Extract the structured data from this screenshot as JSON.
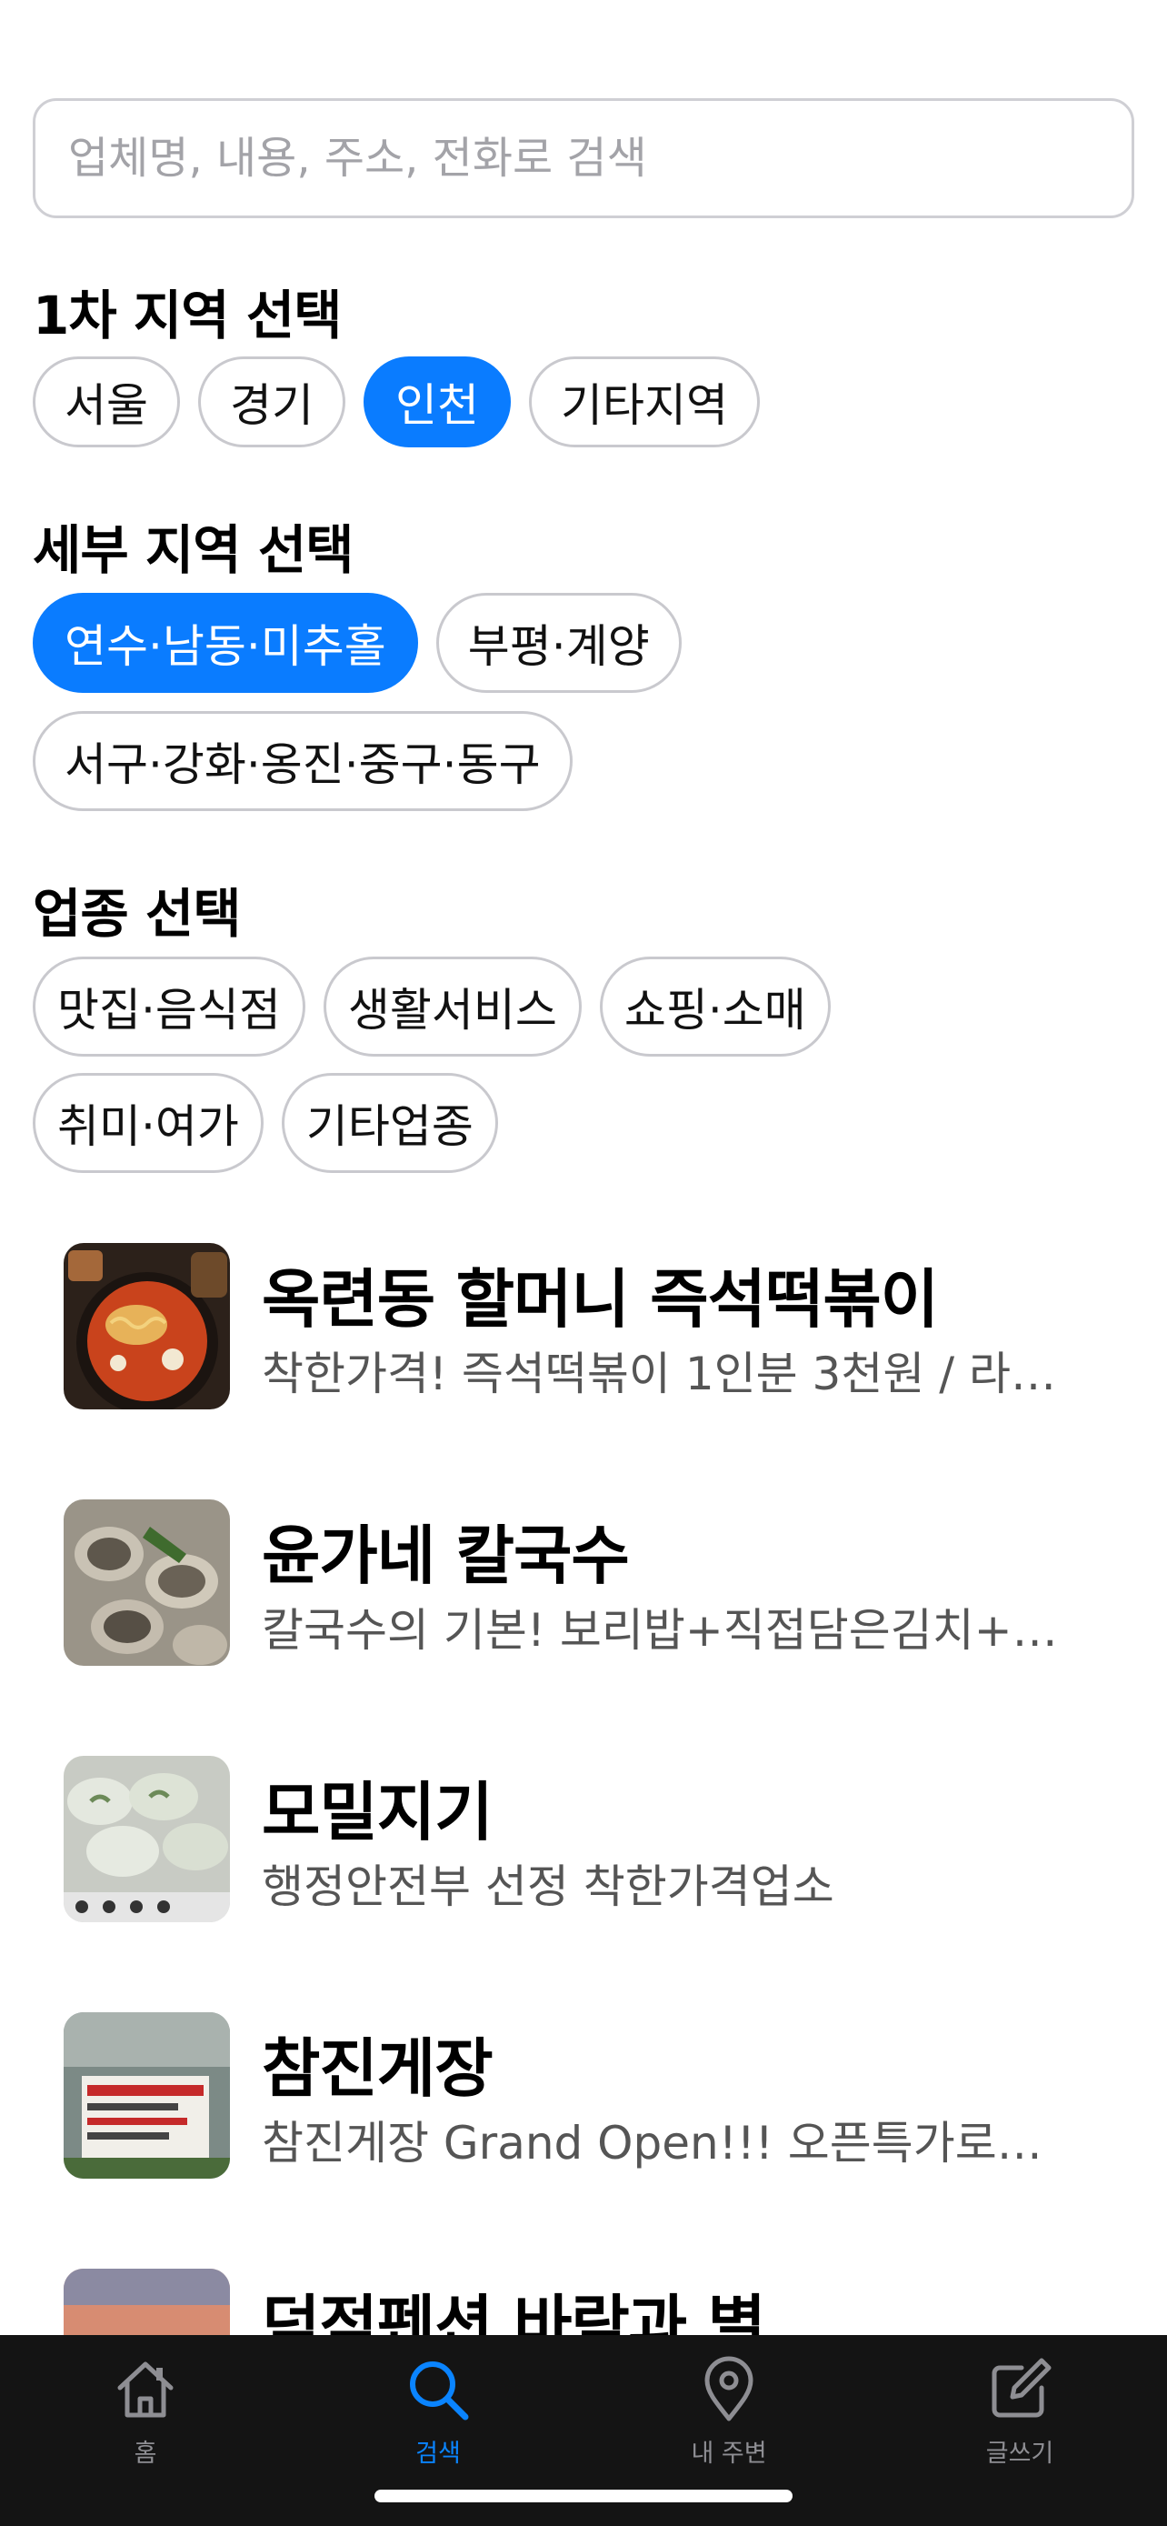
{
  "search": {
    "placeholder": "업체명, 내용, 주소, 전화로 검색",
    "value": ""
  },
  "region1": {
    "title": "1차 지역 선택",
    "chips": [
      "서울",
      "경기",
      "인천",
      "기타지역"
    ],
    "selected": "인천"
  },
  "region2": {
    "title": "세부 지역 선택",
    "chips": [
      "연수·남동·미추홀",
      "부평·계양",
      "서구·강화·옹진·중구·동구"
    ],
    "selected": "연수·남동·미추홀"
  },
  "category": {
    "title": "업종 선택",
    "chips": [
      "맛집·음식점",
      "생활서비스",
      "쇼핑·소매",
      "취미·여가",
      "기타업종"
    ]
  },
  "listings": [
    {
      "title": "옥련동 할머니 즉석떡볶이",
      "desc": "착한가격! 즉석떡볶이 1인분 3천원 / 라…"
    },
    {
      "title": "윤가네 칼국수",
      "desc": "칼국수의 기본! 보리밥+직접담은김치+…"
    },
    {
      "title": "모밀지기",
      "desc": "행정안전부 선정 착한가격업소"
    },
    {
      "title": "참진게장",
      "desc": "참진게장 Grand Open!!! 오픈특가로…"
    },
    {
      "title": "덕적펜션 바람과 별",
      "desc": ""
    }
  ],
  "tabs": [
    {
      "label": "홈",
      "icon": "home-icon"
    },
    {
      "label": "검색",
      "icon": "search-icon"
    },
    {
      "label": "내 주변",
      "icon": "location-pin-icon"
    },
    {
      "label": "글쓰기",
      "icon": "compose-icon"
    }
  ],
  "colors": {
    "accent": "#0a7cff",
    "tabbar": "#141414",
    "inactive_tab": "#8e8e93"
  }
}
